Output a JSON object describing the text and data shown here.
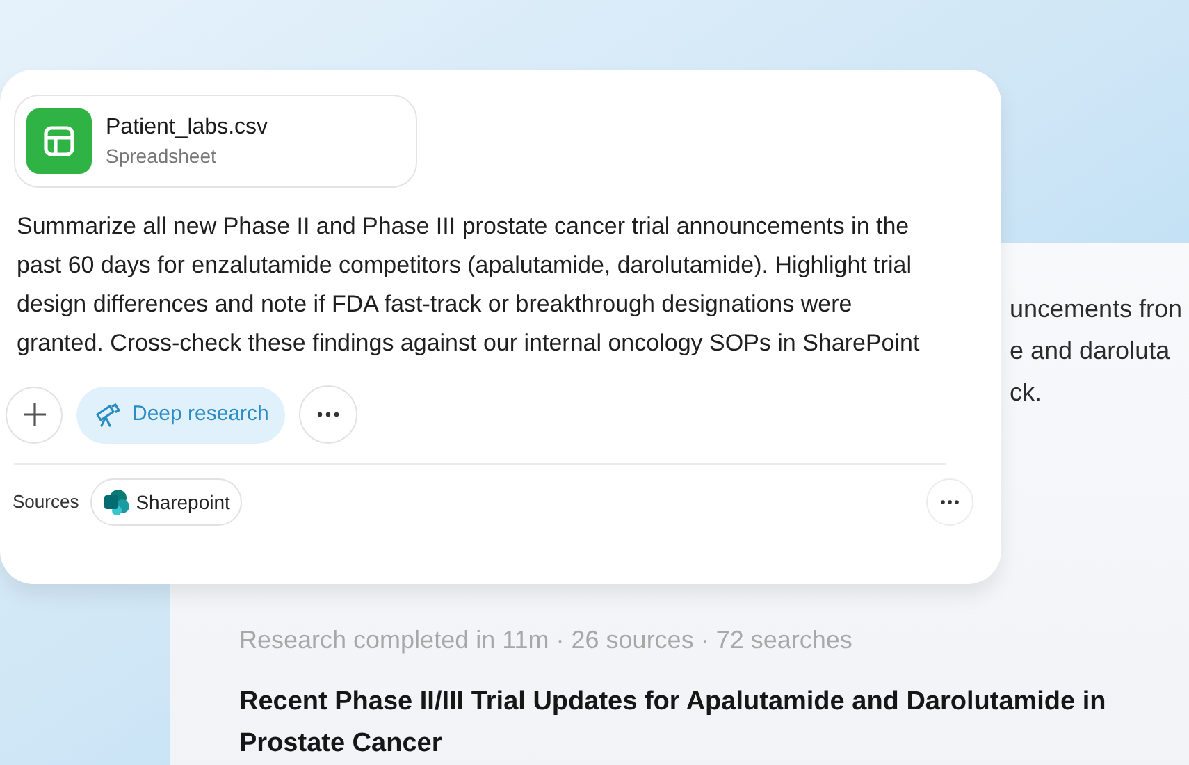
{
  "background_panel": {
    "partial_lines": [
      "uncements fron",
      "e and daroluta",
      "ck."
    ],
    "status": "Research completed in 11m · 26 sources · 72 searches",
    "report_title": "Recent Phase II/III Trial Updates for Apalutamide and Darolutamide in Prostate Cancer"
  },
  "composer": {
    "attachment": {
      "name": "Patient_labs.csv",
      "type": "Spreadsheet"
    },
    "prompt": "Summarize all new Phase II and Phase III prostate cancer trial announcements in the past 60 days for enzalutamide competitors (apalutamide, darolutamide). Highlight trial design differences and note if FDA fast-track or breakthrough designations were granted. Cross-check these findings against our internal oncology SOPs in SharePoint",
    "tools": [
      {
        "kind": "add"
      },
      {
        "kind": "mode",
        "label": "Deep research",
        "selected": true
      },
      {
        "kind": "more"
      }
    ],
    "sources_label": "Sources",
    "sources": [
      {
        "name": "Sharepoint"
      }
    ]
  }
}
